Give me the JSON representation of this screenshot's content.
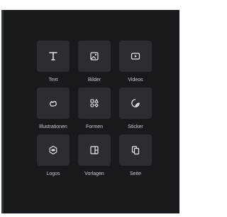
{
  "menu": {
    "items": [
      {
        "label": "Text",
        "icon": "text-icon"
      },
      {
        "label": "Bilder",
        "icon": "image-icon"
      },
      {
        "label": "Videos",
        "icon": "video-icon"
      },
      {
        "label": "Illustrationen",
        "icon": "illustration-icon"
      },
      {
        "label": "Formen",
        "icon": "shapes-icon"
      },
      {
        "label": "Sticker",
        "icon": "sticker-icon"
      },
      {
        "label": "Logos",
        "icon": "logo-icon"
      },
      {
        "label": "Vorlagen",
        "icon": "template-icon"
      },
      {
        "label": "Seite",
        "icon": "page-icon"
      }
    ]
  }
}
